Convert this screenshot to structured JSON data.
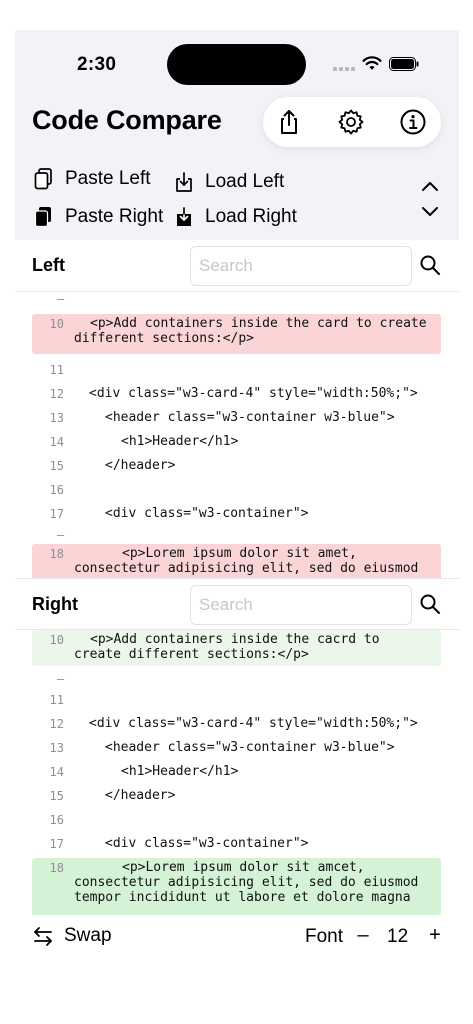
{
  "status": {
    "time": "2:30"
  },
  "app": {
    "title": "Code Compare"
  },
  "actions": {
    "share": "share-icon",
    "settings": "gear-icon",
    "info": "info-icon"
  },
  "toolbar": {
    "paste_left": "Paste Left",
    "load_left": "Load Left",
    "paste_right": "Paste Right",
    "load_right": "Load Right"
  },
  "left": {
    "title": "Left",
    "search_placeholder": "Search",
    "lines": [
      {
        "num": "10",
        "text": "<p>Add containers inside the card to create\ndifferent sections:</p>",
        "indent": "  "
      },
      {
        "num": "11",
        "text": ""
      },
      {
        "num": "12",
        "text": "<div class=\"w3-card-4\" style=\"width:50%;\">"
      },
      {
        "num": "13",
        "text": "<header class=\"w3-container w3-blue\">"
      },
      {
        "num": "14",
        "text": "<h1>Header</h1>"
      },
      {
        "num": "15",
        "text": "</header>"
      },
      {
        "num": "16",
        "text": ""
      },
      {
        "num": "17",
        "text": "<div class=\"w3-container\">"
      },
      {
        "num": "18",
        "text": "<p>Lorem ipsum dolor sit amet,\nconsectetur adipisicing elit, sed do eiusmod"
      }
    ]
  },
  "right": {
    "title": "Right",
    "search_placeholder": "Search",
    "lines": [
      {
        "num": "10",
        "text": "<p>Add containers inside the cacrd to\ncreate different sections:</p>"
      },
      {
        "num": "11",
        "text": ""
      },
      {
        "num": "12",
        "text": "<div class=\"w3-card-4\" style=\"width:50%;\">"
      },
      {
        "num": "13",
        "text": "<header class=\"w3-container w3-blue\">"
      },
      {
        "num": "14",
        "text": "<h1>Header</h1>"
      },
      {
        "num": "15",
        "text": "</header>"
      },
      {
        "num": "16",
        "text": ""
      },
      {
        "num": "17",
        "text": "<div class=\"w3-container\">"
      },
      {
        "num": "18",
        "text": "<p>Lorem ipsum dolor sit amcet,\nconsectetur adipisicing elit, sed do eiusmod\ntempor incididunt ut labore et dolore magna"
      }
    ]
  },
  "bottom": {
    "swap": "Swap",
    "font_label": "Font",
    "font_minus": "–",
    "font_size": "12",
    "font_plus": "+"
  },
  "colors": {
    "removed": "#fbd5d5",
    "added_soft": "#eaf7ea",
    "added": "#d4f2d6"
  }
}
